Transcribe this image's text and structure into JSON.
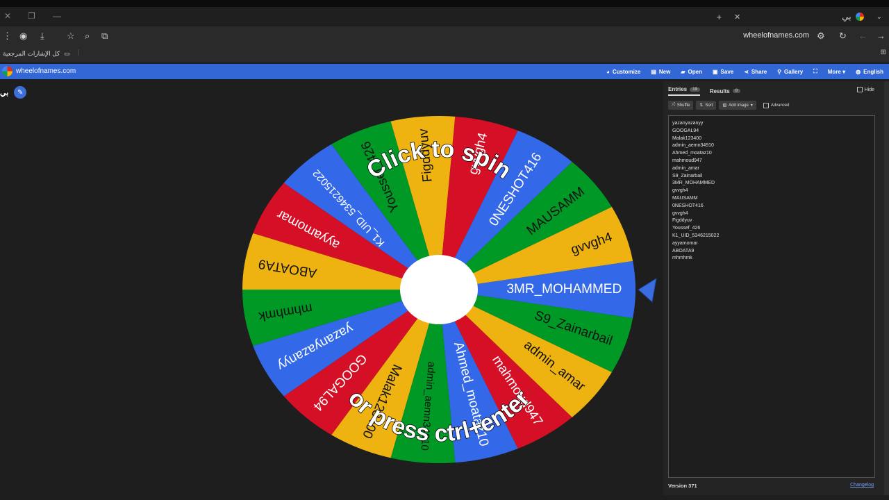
{
  "browser": {
    "active_tab_title": "بي",
    "url": "wheelofnames.com",
    "bookmarks_label": "كل الإشارات المرجعية"
  },
  "app": {
    "brand": "wheelofnames.com",
    "menu": [
      {
        "label": "Customize",
        "icon": "palette-icon",
        "glyph": "◕"
      },
      {
        "label": "New",
        "icon": "file-icon",
        "glyph": "▤"
      },
      {
        "label": "Open",
        "icon": "folder-icon",
        "glyph": "▰"
      },
      {
        "label": "Save",
        "icon": "save-icon",
        "glyph": "▣"
      },
      {
        "label": "Share",
        "icon": "share-icon",
        "glyph": "⋖"
      },
      {
        "label": "Gallery",
        "icon": "search-icon",
        "glyph": "⚲"
      },
      {
        "label": "",
        "icon": "fullscreen-icon",
        "glyph": "⛶"
      },
      {
        "label": "More ▾",
        "icon": "more-icon",
        "glyph": ""
      },
      {
        "label": "English",
        "icon": "globe-icon",
        "glyph": "◍"
      }
    ],
    "wheel_title": "بي"
  },
  "wheel": {
    "center_text_top": "Click to spin",
    "center_text_bottom": "or press ctrl+enter",
    "segment_colors": [
      "#3369e8",
      "#009925",
      "#eeb211",
      "#d50f25"
    ],
    "segments": [
      "3MR_MOHAMMED",
      "S9_Zainarbail",
      "admin_amar",
      "mahmoud947",
      "Ahmed_moataz10",
      "admin_aemn34910",
      "Malak123400",
      "GOOGAL94",
      "yazanyazanyy",
      "mhmhmk",
      "ABOATA9",
      "ayyamomar",
      "K1_UID_5346215022",
      "Youssef_426",
      "Figddyuv",
      "gvvgh4",
      "0NESHOT416",
      "MAUSAMM",
      "gvvgh4"
    ]
  },
  "panel": {
    "tab_entries": "Entries",
    "entries_count": "19",
    "tab_results": "Results",
    "results_count": "0",
    "hide_label": "Hide",
    "shuffle_label": "Shuffle",
    "sort_label": "Sort",
    "add_image_label": "Add image",
    "advanced_label": "Advanced",
    "entries": [
      "yazanyazanyy",
      "GOOGAL94",
      "Malak123400",
      "admin_aemn34910",
      "Ahmed_moataz10",
      "mahmoud947",
      "admin_amar",
      "S9_Zainarbail",
      "3MR_MOHAMMED",
      "gvvgh4",
      "MAUSAMM",
      "0NESHOT416",
      "gvvgh4",
      "Figddyuv",
      "Youssef_426",
      "K1_UID_5346215022",
      "ayyamomar",
      "ABOATA9",
      "mhmhmk"
    ],
    "version": "Version 371",
    "changelog": "Changelog"
  }
}
